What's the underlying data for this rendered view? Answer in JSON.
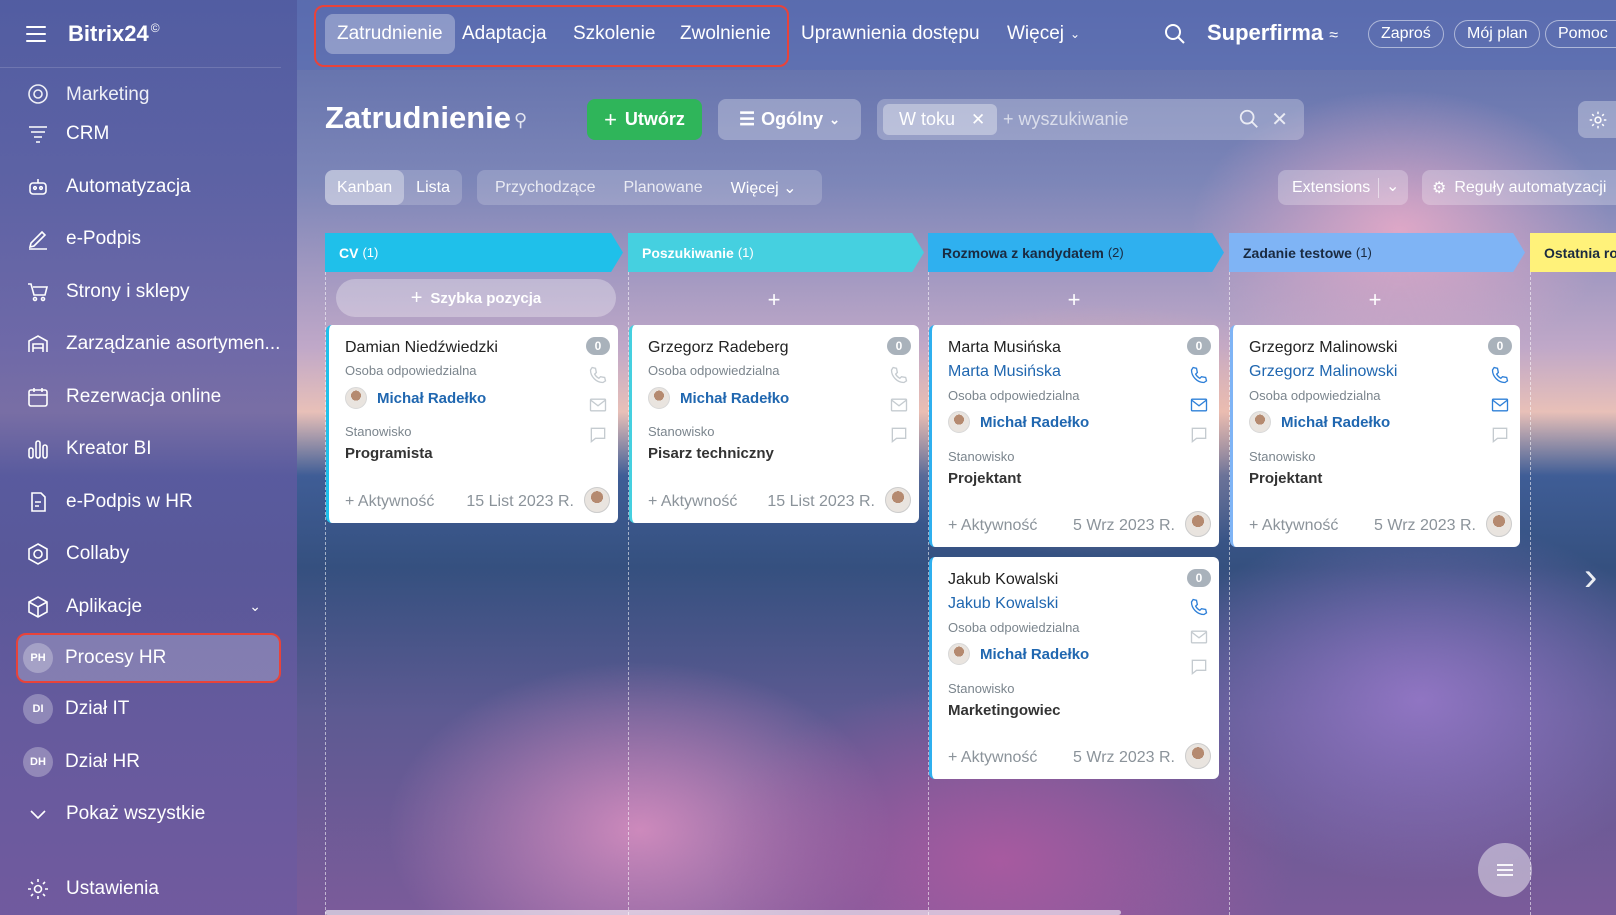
{
  "app": {
    "logo": "Bitrix24",
    "logo_mark": "©"
  },
  "sidebar": {
    "items": [
      {
        "label": "Marketing",
        "icon": "target-icon"
      },
      {
        "label": "CRM",
        "icon": "funnel-icon"
      },
      {
        "label": "Automatyzacja",
        "icon": "robot-icon"
      },
      {
        "label": "e-Podpis",
        "icon": "pen-icon"
      },
      {
        "label": "Strony i sklepy",
        "icon": "cart-icon"
      },
      {
        "label": "Zarządzanie asortymen...",
        "icon": "warehouse-icon"
      },
      {
        "label": "Rezerwacja online",
        "icon": "calendar-icon"
      },
      {
        "label": "Kreator BI",
        "icon": "bar-chart-icon"
      },
      {
        "label": "e-Podpis w HR",
        "icon": "document-sign-icon"
      },
      {
        "label": "Collaby",
        "icon": "hexagon-icon"
      },
      {
        "label": "Aplikacje",
        "icon": "box-icon"
      },
      {
        "label": "Procesy HR",
        "initials": "PH"
      },
      {
        "label": "Dział IT",
        "initials": "DI"
      },
      {
        "label": "Dział HR",
        "initials": "DH"
      },
      {
        "label": "Pokaż wszystkie",
        "icon": "chevron-down-icon"
      }
    ],
    "settings": "Ustawienia"
  },
  "topbar": {
    "tabs": [
      "Zatrudnienie",
      "Adaptacja",
      "Szkolenie",
      "Zwolnienie",
      "Uprawnienia dostępu",
      "Więcej"
    ],
    "brand": "Superfirma",
    "invite": "Zaproś",
    "plan": "Mój plan",
    "help": "Pomoc"
  },
  "page": {
    "title": "Zatrudnienie",
    "create": "Utwórz",
    "general": "Ogólny",
    "filter_tag": "W toku",
    "search_placeholder": "+ wyszukiwanie",
    "views": [
      "Kanban",
      "Lista"
    ],
    "stage_filters": [
      "Przychodzące",
      "Planowane",
      "Więcej"
    ],
    "extensions": "Extensions",
    "automation": "Reguły automatyzacji"
  },
  "kanban": {
    "quick_add": "Szybka pozycja",
    "columns": [
      {
        "title": "CV",
        "count": "(1)",
        "color": "#1fc0ea"
      },
      {
        "title": "Poszukiwanie",
        "count": "(1)",
        "color": "#45d0e0"
      },
      {
        "title": "Rozmowa z kandydatem",
        "count": "(2)",
        "color": "#2fb0ef"
      },
      {
        "title": "Zadanie testowe",
        "count": "(1)",
        "color": "#7fb4f5"
      },
      {
        "title": "Ostatnia ro",
        "count": "",
        "color": "#fff27a"
      }
    ],
    "labels": {
      "responsible": "Osoba odpowiedzialna",
      "position": "Stanowisko",
      "activity": "+ Aktywność"
    },
    "cards": [
      {
        "name": "Damian Niedźwiedzki",
        "badge": "0",
        "contact": "",
        "person": "Michał Radełko",
        "position": "Programista",
        "date": "15 List 2023 R."
      },
      {
        "name": "Grzegorz Radeberg",
        "badge": "0",
        "contact": "",
        "person": "Michał Radełko",
        "position": "Pisarz techniczny",
        "date": "15 List 2023 R."
      },
      {
        "name": "Marta Musińska",
        "badge": "0",
        "contact": "Marta Musińska",
        "person": "Michał Radełko",
        "position": "Projektant",
        "date": "5 Wrz 2023 R."
      },
      {
        "name": "Jakub Kowalski",
        "badge": "0",
        "contact": "Jakub Kowalski",
        "person": "Michał Radełko",
        "position": "Marketingowiec",
        "date": "5 Wrz 2023 R."
      },
      {
        "name": "Grzegorz Malinowski",
        "badge": "0",
        "contact": "Grzegorz Malinowski",
        "person": "Michał Radełko",
        "position": "Projektant",
        "date": "5 Wrz 2023 R."
      }
    ]
  }
}
